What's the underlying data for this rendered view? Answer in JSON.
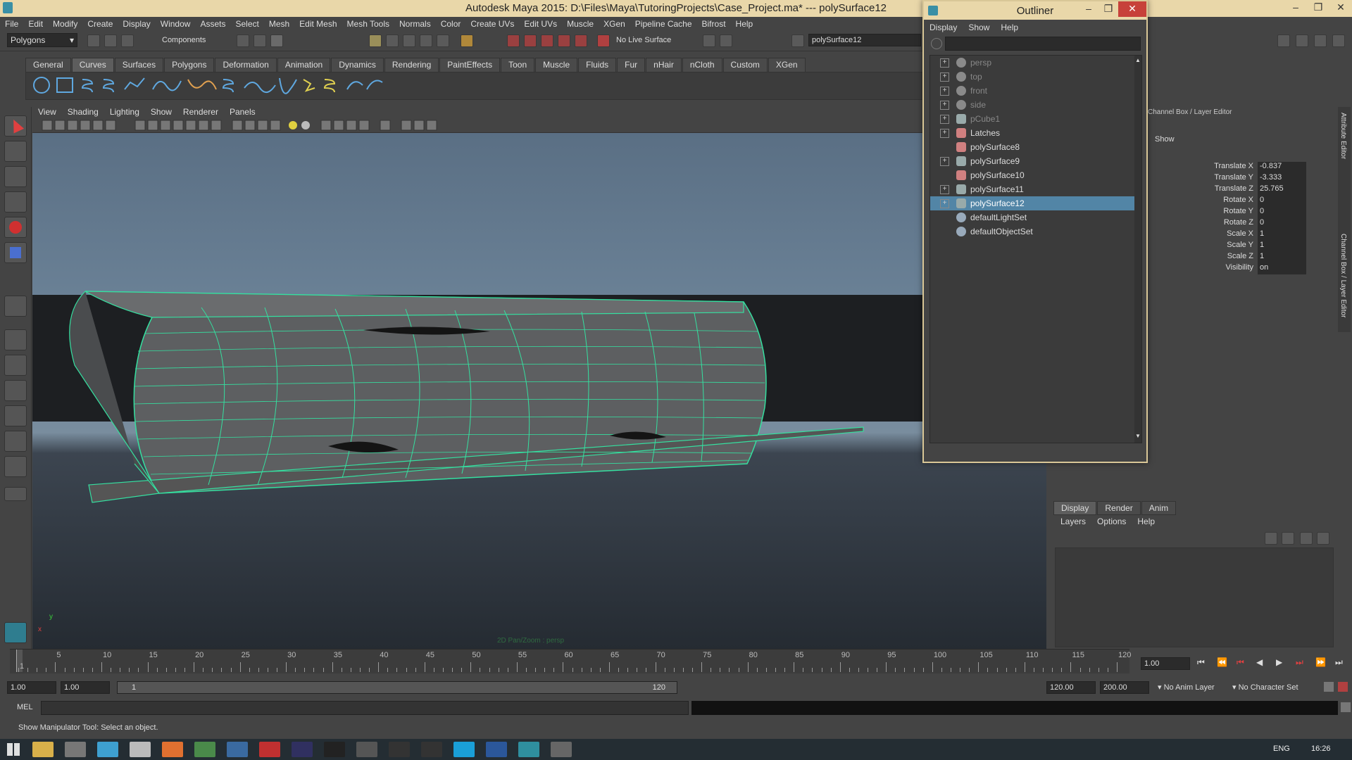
{
  "window": {
    "title": "Autodesk Maya 2015: D:\\Files\\Maya\\TutoringProjects\\Case_Project.ma*   ---   polySurface12",
    "controls": [
      "–",
      "❐",
      "✕"
    ]
  },
  "menubar": [
    "File",
    "Edit",
    "Modify",
    "Create",
    "Display",
    "Window",
    "Assets",
    "Select",
    "Mesh",
    "Edit Mesh",
    "Mesh Tools",
    "Normals",
    "Color",
    "Create UVs",
    "Edit UVs",
    "Muscle",
    "XGen",
    "Pipeline Cache",
    "Bifrost",
    "Help"
  ],
  "statusline": {
    "mode": "Polygons",
    "components_label": "Components",
    "live_surface": "No Live Surface",
    "object_name": "polySurface12"
  },
  "shelf_tabs": [
    "General",
    "Curves",
    "Surfaces",
    "Polygons",
    "Deformation",
    "Animation",
    "Dynamics",
    "Rendering",
    "PaintEffects",
    "Toon",
    "Muscle",
    "Fluids",
    "Fur",
    "nHair",
    "nCloth",
    "Custom",
    "XGen"
  ],
  "shelf_active": "Curves",
  "viewport_menu": [
    "View",
    "Shading",
    "Lighting",
    "Show",
    "Renderer",
    "Panels"
  ],
  "viewport": {
    "camera_label": "2D Pan/Zoom : persp",
    "axis_x": "x",
    "axis_y": "y"
  },
  "outliner": {
    "title": "Outliner",
    "menu": [
      "Display",
      "Show",
      "Help"
    ],
    "items": [
      {
        "label": "persp",
        "expand": true,
        "dim": true,
        "icon": "camera-icon"
      },
      {
        "label": "top",
        "expand": true,
        "dim": true,
        "icon": "camera-icon"
      },
      {
        "label": "front",
        "expand": true,
        "dim": true,
        "icon": "camera-icon"
      },
      {
        "label": "side",
        "expand": true,
        "dim": true,
        "icon": "camera-icon"
      },
      {
        "label": "pCube1",
        "expand": true,
        "dim": true,
        "icon": "transform-icon"
      },
      {
        "label": "Latches",
        "expand": true,
        "dim": false,
        "icon": "mesh-icon"
      },
      {
        "label": "polySurface8",
        "expand": false,
        "dim": false,
        "icon": "mesh-icon"
      },
      {
        "label": "polySurface9",
        "expand": true,
        "dim": false,
        "icon": "transform-icon"
      },
      {
        "label": "polySurface10",
        "expand": false,
        "dim": false,
        "icon": "mesh-icon"
      },
      {
        "label": "polySurface11",
        "expand": true,
        "dim": false,
        "icon": "transform-icon"
      },
      {
        "label": "polySurface12",
        "expand": true,
        "dim": false,
        "icon": "transform-icon",
        "selected": true
      },
      {
        "label": "defaultLightSet",
        "expand": false,
        "dim": false,
        "icon": "set-icon"
      },
      {
        "label": "defaultObjectSet",
        "expand": false,
        "dim": false,
        "icon": "set-icon"
      }
    ]
  },
  "channel_box": {
    "title": "Channel Box / Layer Editor",
    "show_label": "Show",
    "channels": [
      {
        "label": "Translate X",
        "value": "-0.837"
      },
      {
        "label": "Translate Y",
        "value": "-3.333"
      },
      {
        "label": "Translate Z",
        "value": "25.765"
      },
      {
        "label": "Rotate X",
        "value": "0"
      },
      {
        "label": "Rotate Y",
        "value": "0"
      },
      {
        "label": "Rotate Z",
        "value": "0"
      },
      {
        "label": "Scale X",
        "value": "1"
      },
      {
        "label": "Scale Y",
        "value": "1"
      },
      {
        "label": "Scale Z",
        "value": "1"
      },
      {
        "label": "Visibility",
        "value": "on"
      }
    ],
    "side_tabs": [
      "Attribute Editor",
      "Channel Box / Layer Editor"
    ]
  },
  "layer_editor": {
    "tabs": [
      "Display",
      "Render",
      "Anim"
    ],
    "active_tab": "Display",
    "menu": [
      "Layers",
      "Options",
      "Help"
    ]
  },
  "timeslider": {
    "labels": [
      "1",
      "5",
      "10",
      "15",
      "20",
      "25",
      "30",
      "35",
      "40",
      "45",
      "50",
      "55",
      "60",
      "65",
      "70",
      "75",
      "80",
      "85",
      "90",
      "95",
      "100",
      "105",
      "110",
      "115",
      "120"
    ],
    "current_frame": "1.00"
  },
  "range": {
    "start": "1.00",
    "playback_start": "1.00",
    "slider_start": "1",
    "slider_end": "120",
    "playback_end": "120.00",
    "end": "200.00",
    "anim_layer": "No Anim Layer",
    "character_set": "No Character Set"
  },
  "command_line": {
    "label": "MEL"
  },
  "help_line": "Show Manipulator Tool: Select an object.",
  "taskbar": {
    "language": "ENG",
    "time": "16:26"
  },
  "colors": {
    "accent": "#5285a6",
    "wire": "#35e0a0",
    "title": "#e9d7a9"
  }
}
